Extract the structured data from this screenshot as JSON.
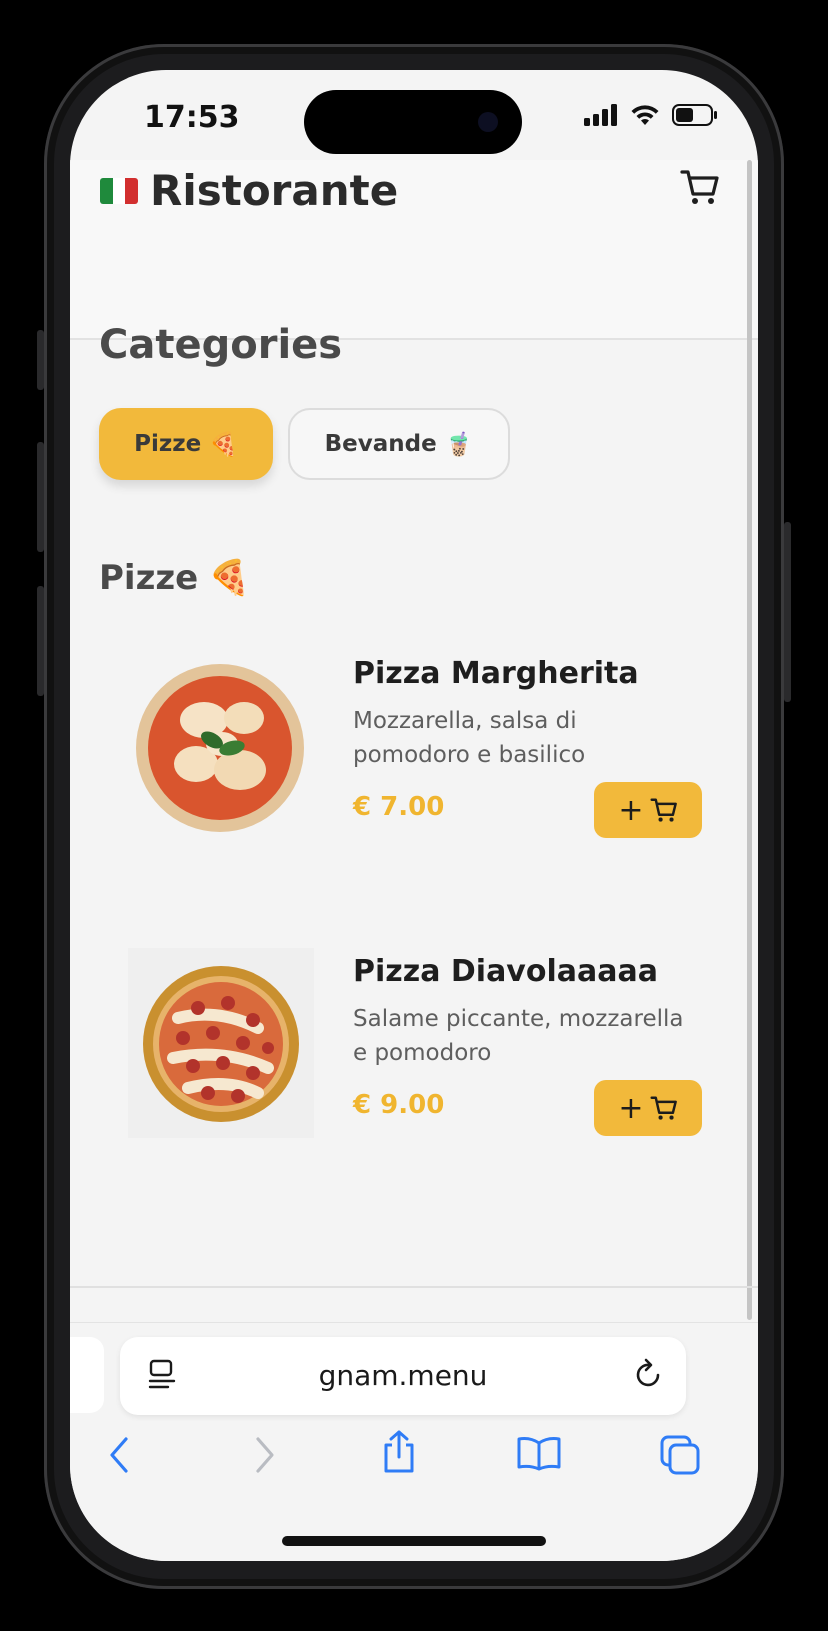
{
  "status_bar": {
    "time": "17:53"
  },
  "header": {
    "brand": "Ristorante",
    "flag_colors": [
      "#1f8a3c",
      "#ffffff",
      "#d22f2f"
    ]
  },
  "categories": {
    "title": "Categories",
    "chips": [
      {
        "label": "Pizze",
        "emoji": "🍕",
        "active": true
      },
      {
        "label": "Bevande",
        "emoji": "🧋",
        "active": false
      }
    ]
  },
  "section": {
    "title": "Pizze",
    "emoji": "🍕"
  },
  "products": [
    {
      "name": "Pizza Margherita",
      "desc": "Mozzarella, salsa di pomodoro e basilico",
      "price": "€ 7.00",
      "add_label": "+"
    },
    {
      "name": "Pizza Diavolaaaaa",
      "desc": "Salame piccante, mozzarella e pomodoro",
      "price": "€ 9.00",
      "add_label": "+"
    }
  ],
  "browser": {
    "url": "gnam.menu"
  },
  "colors": {
    "accent": "#f2b93b",
    "price": "#f0b52f",
    "ios_blue": "#2f7cf6"
  },
  "icons": [
    "cart-icon",
    "reader-icon",
    "reload-icon",
    "back-icon",
    "forward-icon",
    "share-icon",
    "bookmarks-icon",
    "tabs-icon"
  ]
}
